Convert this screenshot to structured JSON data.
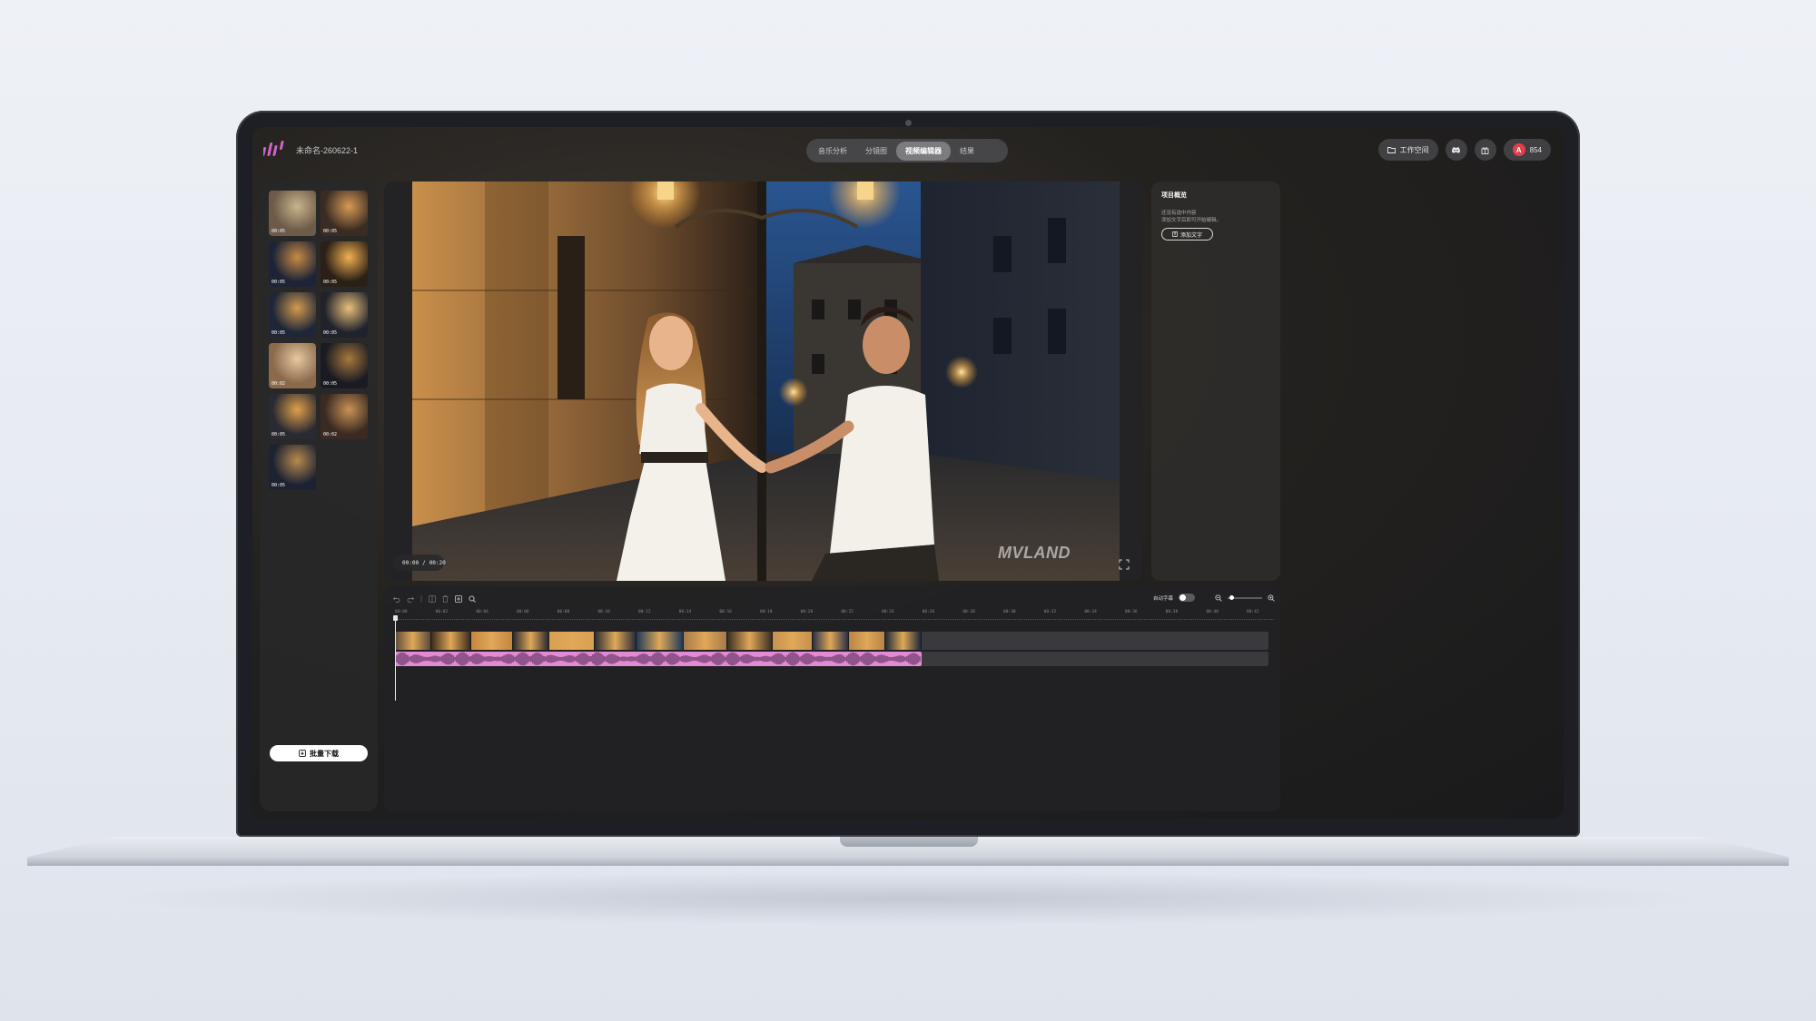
{
  "app": {
    "project_name": "未命名-260622-1",
    "logo_icon": "waveform-logo-icon"
  },
  "tabs": [
    {
      "label": "音乐分析",
      "active": false
    },
    {
      "label": "分镜图",
      "active": false
    },
    {
      "label": "视频编辑器",
      "active": true
    },
    {
      "label": "结果",
      "active": false
    }
  ],
  "topbar": {
    "workspace_label": "工作空间",
    "credits": "854",
    "credit_badge": "A"
  },
  "media": {
    "thumbnails": [
      {
        "duration": "00:05"
      },
      {
        "duration": "00:05"
      },
      {
        "duration": "00:05"
      },
      {
        "duration": "00:05"
      },
      {
        "duration": "00:05"
      },
      {
        "duration": "00:05"
      },
      {
        "duration": "00:02"
      },
      {
        "duration": "00:05"
      },
      {
        "duration": "00:05"
      },
      {
        "duration": "00:02"
      },
      {
        "duration": "00:05"
      }
    ],
    "batch_download_label": "批量下载"
  },
  "preview": {
    "time_current": "00:00",
    "time_separator": "/",
    "time_total": "00:20",
    "watermark": "MVLAND"
  },
  "overview": {
    "title": "项目概览",
    "hint_line1": "还没有选中内容",
    "hint_line2": "添加文字后即可开始编辑。",
    "add_text_label": "添加文字"
  },
  "timeline": {
    "auto_subtitle_label": "自动字幕",
    "auto_subtitle_on": false,
    "ruler": [
      "00:00",
      "00:02",
      "00:04",
      "00:06",
      "00:08",
      "00:10",
      "00:12",
      "00:14",
      "00:16",
      "00:18",
      "00:20",
      "00:22",
      "00:24",
      "00:26",
      "00:28",
      "00:30",
      "00:32",
      "00:34",
      "00:36",
      "00:38",
      "00:40",
      "00:42"
    ]
  },
  "colors": {
    "accent_pink": "#e28ad3",
    "credit_red": "#e0404a",
    "active_tab": "#7b7b80"
  }
}
